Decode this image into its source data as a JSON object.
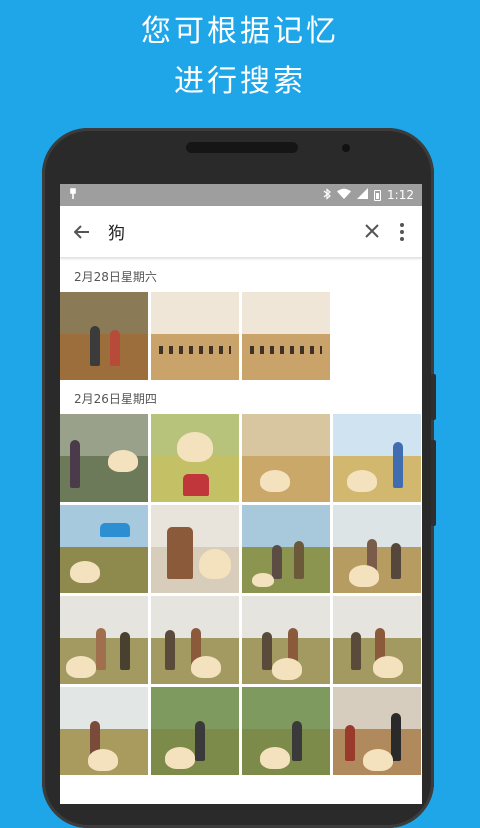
{
  "promo": {
    "line1": "您可根据记忆",
    "line2": "进行搜索"
  },
  "statusbar": {
    "time": "1:12",
    "icons": [
      "usb-icon",
      "bluetooth-icon",
      "wifi-icon",
      "signal-icon",
      "battery-icon"
    ]
  },
  "search": {
    "query": "狗",
    "back_icon": "arrow-left-icon",
    "clear_icon": "close-icon",
    "menu_icon": "more-vert-icon"
  },
  "sections": [
    {
      "date": "2月28日星期六",
      "photo_count": 3
    },
    {
      "date": "2月26日星期四",
      "photo_count": 16
    }
  ],
  "colors": {
    "background": "#1ea6e9",
    "statusbar": "#9e9e9e"
  }
}
